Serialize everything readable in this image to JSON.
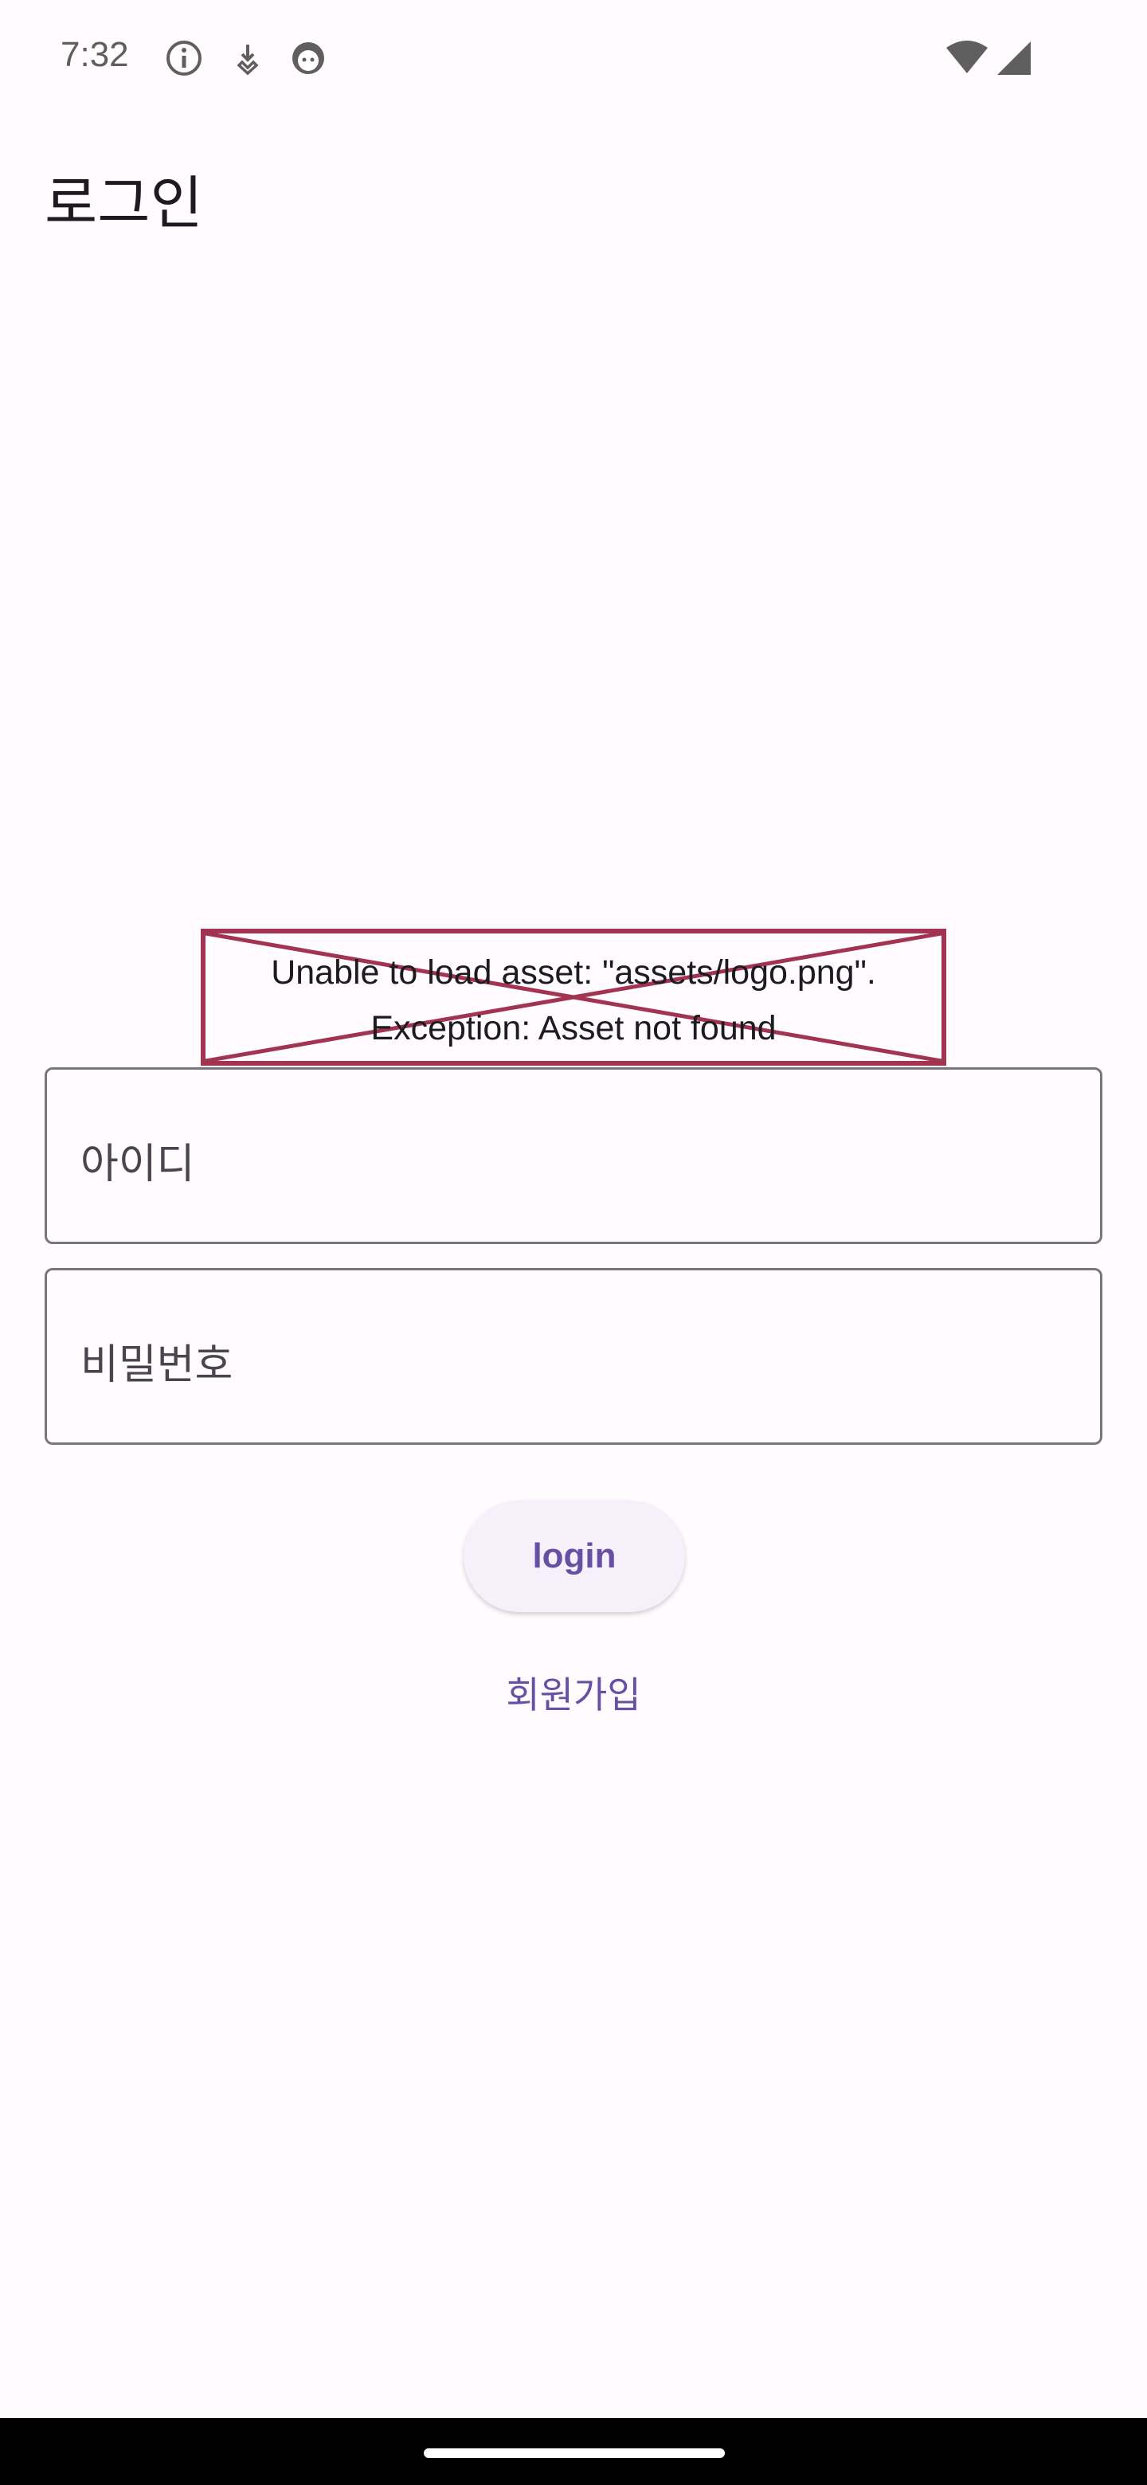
{
  "status_bar": {
    "time": "7:32",
    "icons": [
      "info-icon",
      "download-icon",
      "android-icon",
      "wifi-icon",
      "cellular-signal-icon"
    ]
  },
  "app_bar": {
    "title": "로그인"
  },
  "logo": {
    "error_line1": "Unable to load asset: \"assets/logo.png\".",
    "error_line2": "Exception: Asset not found",
    "border_color": "#a33451"
  },
  "form": {
    "id_label": "아이디",
    "password_label": "비밀번호",
    "login_label": "login",
    "signup_label": "회원가입"
  },
  "colors": {
    "accent": "#6750a4",
    "background": "#fffbfe",
    "outline": "#79747e"
  }
}
